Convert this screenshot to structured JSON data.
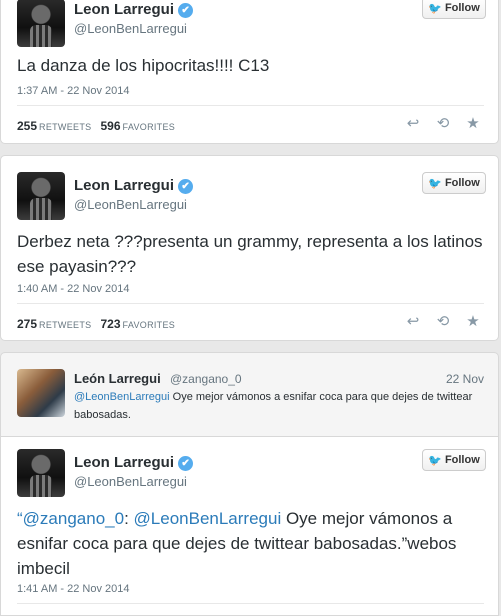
{
  "tweets": [
    {
      "name": "Leon Larregui",
      "handle": "@LeonBenLarregui",
      "follow_label": "Follow",
      "text": "La danza de los hipocritas!!!! C13",
      "time": "1:37 AM - 22 Nov 2014",
      "retweets": "255",
      "retweets_label": "RETWEETS",
      "favorites": "596",
      "favorites_label": "FAVORITES"
    },
    {
      "name": "Leon Larregui",
      "handle": "@LeonBenLarregui",
      "follow_label": "Follow",
      "text": "Derbez neta ???presenta un grammy, representa a los latinos ese payasin???",
      "time": "1:40 AM - 22 Nov 2014",
      "retweets": "275",
      "retweets_label": "RETWEETS",
      "favorites": "723",
      "favorites_label": "FAVORITES"
    },
    {
      "name": "Leon Larregui",
      "handle": "@LeonBenLarregui",
      "follow_label": "Follow",
      "text_open_quote": "“",
      "text_mention1": "@zangano_0",
      "text_colon": ": ",
      "text_mention2": "@LeonBenLarregui",
      "text_rest": " Oye mejor vámonos a esnifar coca para que dejes de twittear babosadas.”webos imbecil",
      "time": "1:41 AM - 22 Nov 2014"
    }
  ],
  "reply": {
    "name": "León Larregui",
    "handle": "@zangano_0",
    "date": "22 Nov",
    "mention": "@LeonBenLarregui",
    "text": " Oye mejor vámonos a esnifar coca para que dejes de twittear babosadas."
  },
  "icons": {
    "verified": "✔",
    "bird": "🐦",
    "reply": "↩",
    "retweet": "⟲",
    "favorite": "★"
  },
  "colors": {
    "accent": "#55acee",
    "link": "#2b7bb9"
  }
}
